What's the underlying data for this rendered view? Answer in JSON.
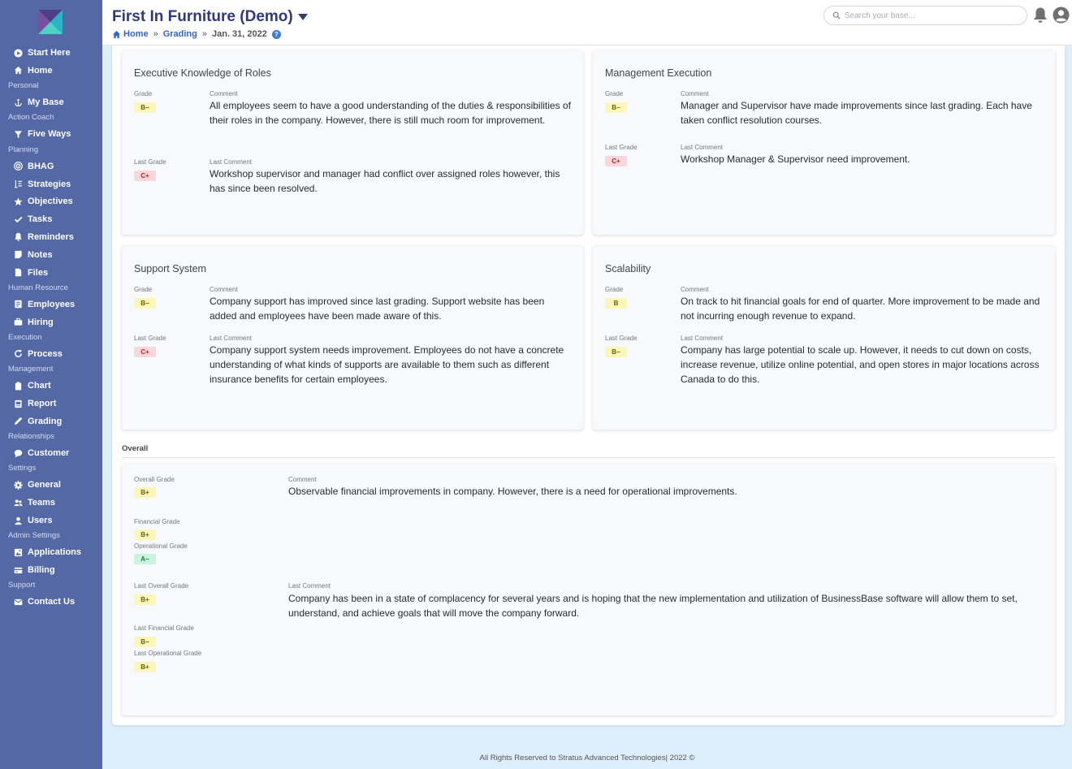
{
  "sidebar": {
    "top": [
      {
        "label": "Start Here",
        "icon": "play-circle-icon"
      },
      {
        "label": "Home",
        "icon": "home-icon"
      }
    ],
    "sections": [
      {
        "title": "Personal",
        "items": [
          {
            "label": "My Base",
            "icon": "anchor-icon"
          }
        ]
      },
      {
        "title": "Action Coach",
        "items": [
          {
            "label": "Five Ways",
            "icon": "filter-icon"
          }
        ]
      },
      {
        "title": "Planning",
        "items": [
          {
            "label": "BHAG",
            "icon": "target-icon"
          },
          {
            "label": "Strategies",
            "icon": "chess-icon"
          },
          {
            "label": "Objectives",
            "icon": "star-icon"
          },
          {
            "label": "Tasks",
            "icon": "check-icon"
          },
          {
            "label": "Reminders",
            "icon": "bell-icon"
          },
          {
            "label": "Notes",
            "icon": "note-icon"
          },
          {
            "label": "Files",
            "icon": "file-icon"
          }
        ]
      },
      {
        "title": "Human Resource",
        "items": [
          {
            "label": "Employees",
            "icon": "id-card-icon"
          },
          {
            "label": "Hiring",
            "icon": "briefcase-icon"
          }
        ]
      },
      {
        "title": "Execution",
        "items": [
          {
            "label": "Process",
            "icon": "refresh-icon"
          }
        ]
      },
      {
        "title": "Management",
        "items": [
          {
            "label": "Chart",
            "icon": "clipboard-icon"
          },
          {
            "label": "Report",
            "icon": "report-icon"
          },
          {
            "label": "Grading",
            "icon": "pen-icon"
          }
        ]
      },
      {
        "title": "Relationships",
        "items": [
          {
            "label": "Customer",
            "icon": "chat-icon"
          }
        ]
      },
      {
        "title": "Settings",
        "items": [
          {
            "label": "General",
            "icon": "gear-icon"
          },
          {
            "label": "Teams",
            "icon": "users-icon"
          },
          {
            "label": "Users",
            "icon": "user-icon"
          }
        ]
      },
      {
        "title": "Admin Settings",
        "items": [
          {
            "label": "Applications",
            "icon": "image-icon"
          },
          {
            "label": "Billing",
            "icon": "billing-icon"
          }
        ]
      },
      {
        "title": "Support",
        "items": [
          {
            "label": "Contact Us",
            "icon": "envelope-icon"
          }
        ]
      }
    ]
  },
  "header": {
    "company": "First In Furniture (Demo)",
    "breadcrumb": {
      "home": "Home",
      "sep": "»",
      "section": "Grading",
      "date": "Jan. 31, 2022",
      "help": "?"
    },
    "search_placeholder": "Search your base..."
  },
  "labels": {
    "grade": "Grade",
    "comment": "Comment",
    "last_grade": "Last Grade",
    "last_comment": "Last Comment"
  },
  "cards": [
    {
      "title": "Executive Knowledge of Roles",
      "grade": "B−",
      "grade_color": "yellow",
      "comment": "All employees seem to have a good understanding of the duties & responsibilities of their roles in the company. However, there is still much room for improvement.",
      "last_grade": "C+",
      "last_grade_color": "red",
      "last_comment": "Workshop supervisor and manager had conflict over assigned roles however, this has since been resolved."
    },
    {
      "title": "Management Execution",
      "grade": "B−",
      "grade_color": "yellow",
      "comment": "Manager and Supervisor have made improvements since last grading. Each have taken conflict resolution courses.",
      "last_grade": "C+",
      "last_grade_color": "red",
      "last_comment": "Workshop Manager & Supervisor need improvement."
    },
    {
      "title": "Support System",
      "grade": "B−",
      "grade_color": "yellow",
      "comment": "Company support has improved since last grading. Support website has been added and employees have been made aware of this.",
      "last_grade": "C+",
      "last_grade_color": "red",
      "last_comment": "Company support system needs improvement. Employees do not have a concrete understanding of what kinds of supports are available to them such as different insurance benefits for certain employees."
    },
    {
      "title": "Scalability",
      "grade": "B",
      "grade_color": "yellow",
      "comment": "On track to hit financial goals for end of quarter. More improvement to be made and not incurring enough revenue to expand.",
      "last_grade": "B−",
      "last_grade_color": "yellow",
      "last_comment": "Company has large potential to scale up. However, it needs to cut down on costs, increase revenue, utilize online potential, and open stores in major locations across Canada to do this."
    }
  ],
  "overall": {
    "heading": "Overall",
    "overall_grade_label": "Overall Grade",
    "overall_grade": "B+",
    "comment_label": "Comment",
    "comment": "Observable financial improvements in company. However, there is a need for operational improvements.",
    "financial_grade_label": "Financial Grade",
    "financial_grade": "B+",
    "operational_grade_label": "Operational Grade",
    "operational_grade": "A−",
    "last_overall_grade_label": "Last Overall Grade",
    "last_overall_grade": "B+",
    "last_comment_label": "Last Comment",
    "last_comment": "Company has been in a state of complacency for several years and is hoping that the new implementation and utilization of BusinessBase software will allow them to set, understand, and achieve goals that will move the company forward.",
    "last_financial_grade_label": "Last Financial Grade",
    "last_financial_grade": "B−",
    "last_operational_grade_label": "Last Operational Grade",
    "last_operational_grade": "B+"
  },
  "footer": "All Rights Reserved to Stratus Advanced Technologies| 2022 ©",
  "colors": {
    "sidebar": "#5468a6",
    "title": "#2e3a7a",
    "link": "#3366cc",
    "badge_yellow": "#fbf7b8",
    "badge_red": "#fbd6da",
    "badge_green": "#c9f4de"
  }
}
